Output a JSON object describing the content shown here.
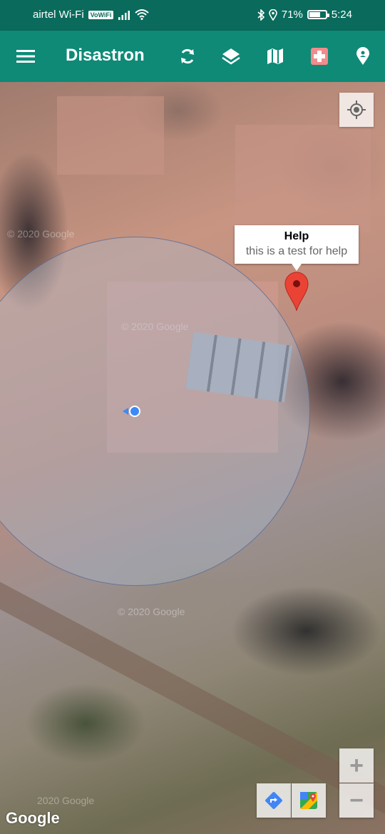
{
  "status_bar": {
    "carrier": "airtel Wi-Fi",
    "vowifi": "VoWiFi",
    "battery_percent": "71%",
    "battery_level": 0.71,
    "time": "5:24",
    "icons": [
      "signal-icon",
      "wifi-icon",
      "bluetooth-icon",
      "location-icon",
      "battery-icon"
    ]
  },
  "app_bar": {
    "title": "Disastron",
    "actions": [
      "menu-icon",
      "refresh-icon",
      "layers-icon",
      "map-icon",
      "medical-cross-icon",
      "location-pin-icon"
    ],
    "accent": "#0e8a77",
    "status_color": "#0a6b5c",
    "medical_icon_bg": "#f28b8b"
  },
  "map": {
    "marker_popup": {
      "title": "Help",
      "snippet": "this is a test for help"
    },
    "marker_color": "#ea4335",
    "my_location_color": "#3d8af7",
    "attribution": "Google",
    "watermark": "© 2020 Google",
    "watermark_short": "2020 Google",
    "controls": [
      "my-location-icon",
      "directions-icon",
      "google-maps-icon",
      "zoom-in-icon",
      "zoom-out-icon"
    ],
    "zoom_in_label": "+",
    "zoom_out_label": "−"
  }
}
